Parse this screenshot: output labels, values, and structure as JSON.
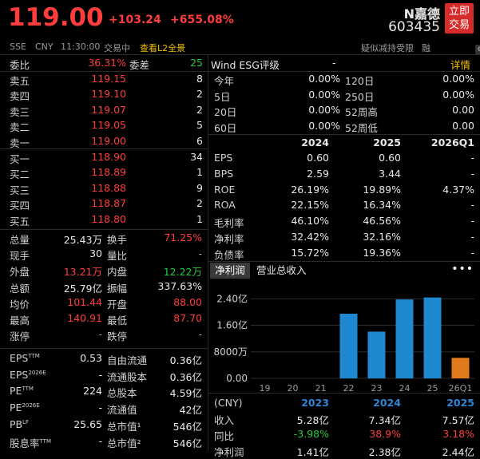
{
  "header": {
    "price": "119.00",
    "change": "+103.24",
    "change_pct": "+655.08%",
    "name": "N嘉德",
    "code": "603435",
    "trade_btn_line1": "立即",
    "trade_btn_line2": "交易"
  },
  "subheader": {
    "exchange": "SSE",
    "currency": "CNY",
    "time": "11:30:00",
    "status": "交易中",
    "l2_link": "查看L2全景",
    "notice": "疑似减持受限",
    "margin": "融"
  },
  "orderbook": {
    "weibi_label": "委比",
    "weibi_value": "36.31%",
    "weicha_label": "委差",
    "weicha_value": "25",
    "asks": [
      {
        "label": "卖五",
        "price": "119.15",
        "vol": "8"
      },
      {
        "label": "卖四",
        "price": "119.10",
        "vol": "2"
      },
      {
        "label": "卖三",
        "price": "119.07",
        "vol": "2"
      },
      {
        "label": "卖二",
        "price": "119.05",
        "vol": "5"
      },
      {
        "label": "卖一",
        "price": "119.00",
        "vol": "6"
      }
    ],
    "bids": [
      {
        "label": "买一",
        "price": "118.90",
        "vol": "34"
      },
      {
        "label": "买二",
        "price": "118.89",
        "vol": "1"
      },
      {
        "label": "买三",
        "price": "118.88",
        "vol": "9"
      },
      {
        "label": "买四",
        "price": "118.87",
        "vol": "2"
      },
      {
        "label": "买五",
        "price": "118.80",
        "vol": "1"
      }
    ]
  },
  "stats": [
    {
      "l1": "总量",
      "v1": "25.43万",
      "l2": "换手",
      "v2": "71.25%"
    },
    {
      "l1": "现手",
      "v1": "30",
      "l2": "量比",
      "v2": "-"
    },
    {
      "l1": "外盘",
      "v1": "13.21万",
      "l2": "内盘",
      "v2": "12.22万"
    },
    {
      "l1": "总额",
      "v1": "25.79亿",
      "l2": "振幅",
      "v2": "337.63%"
    },
    {
      "l1": "均价",
      "v1": "101.44",
      "l2": "开盘",
      "v2": "88.00"
    },
    {
      "l1": "最高",
      "v1": "140.91",
      "l2": "最低",
      "v2": "87.70"
    },
    {
      "l1": "涨停",
      "v1": "-",
      "l2": "跌停",
      "v2": "-"
    }
  ],
  "fundamentals": [
    {
      "l1": "EPS",
      "s1": "TTM",
      "v1": "0.53",
      "l2": "自由流通",
      "v2": "0.36亿"
    },
    {
      "l1": "EPS",
      "s1": "2026E",
      "v1": "-",
      "l2": "流通股本",
      "v2": "0.36亿"
    },
    {
      "l1": "PE",
      "s1": "TTM",
      "v1": "224",
      "l2": "总股本",
      "v2": "4.59亿"
    },
    {
      "l1": "PE",
      "s1": "2026E",
      "v1": "-",
      "l2": "流通值",
      "v2": "42亿"
    },
    {
      "l1": "PB",
      "s1": "LF",
      "v1": "25.65",
      "l2": "总市值¹",
      "v2": "546亿"
    },
    {
      "l1": "股息率",
      "s1": "TTM",
      "v1": "-",
      "l2": "总市值²",
      "v2": "546亿"
    }
  ],
  "wind": {
    "label": "Wind  ESG评级",
    "value": "-",
    "detail": "详情"
  },
  "returns": [
    {
      "l1": "今年",
      "v1": "0.00%",
      "l2": "120日",
      "v2": "0.00%"
    },
    {
      "l1": "5日",
      "v1": "0.00%",
      "l2": "250日",
      "v2": "0.00%"
    },
    {
      "l1": "20日",
      "v1": "0.00%",
      "l2": "52周高",
      "v2": "0.00"
    },
    {
      "l1": "60日",
      "v1": "0.00%",
      "l2": "52周低",
      "v2": "0.00"
    }
  ],
  "ratios": {
    "headers": [
      "2024",
      "2025",
      "2026Q1"
    ],
    "rows": [
      {
        "label": "EPS",
        "v": [
          "0.60",
          "0.60",
          "-"
        ]
      },
      {
        "label": "BPS",
        "v": [
          "2.59",
          "3.44",
          "-"
        ]
      },
      {
        "label": "ROE",
        "v": [
          "26.19%",
          "19.89%",
          "4.37%"
        ]
      },
      {
        "label": "ROA",
        "v": [
          "22.15%",
          "16.34%",
          "-"
        ]
      },
      {
        "label": "毛利率",
        "v": [
          "46.10%",
          "46.56%",
          "-"
        ]
      },
      {
        "label": "净利率",
        "v": [
          "32.42%",
          "32.16%",
          "-"
        ]
      },
      {
        "label": "负债率",
        "v": [
          "15.72%",
          "19.36%",
          "-"
        ]
      }
    ]
  },
  "tabs": {
    "active": "净利润",
    "other": "营业总收入"
  },
  "chart_data": {
    "type": "bar",
    "categories": [
      "19",
      "20",
      "21",
      "22",
      "23",
      "24",
      "25",
      "26Q1"
    ],
    "values": [
      null,
      null,
      null,
      1.95,
      1.41,
      2.38,
      2.44,
      0.62
    ],
    "y_ticks": [
      "2.40亿",
      "1.60亿",
      "8000万",
      "0.00"
    ],
    "y_tick_values": [
      2.4,
      1.6,
      0.8,
      0
    ],
    "ylim": [
      0,
      2.6
    ],
    "colors": {
      "annual": "#1e88d0",
      "quarter": "#e07a1a"
    }
  },
  "income_table": {
    "unit": "(CNY)",
    "years": [
      "2023",
      "2024",
      "2025"
    ],
    "rows": [
      {
        "label": "收入",
        "v": [
          "5.28亿",
          "7.34亿",
          "7.57亿"
        ]
      },
      {
        "label": "同比",
        "v": [
          "-3.98%",
          "38.9%",
          "3.18%"
        ]
      },
      {
        "label": "净利润",
        "v": [
          "1.41亿",
          "2.38亿",
          "2.44亿"
        ]
      }
    ]
  }
}
